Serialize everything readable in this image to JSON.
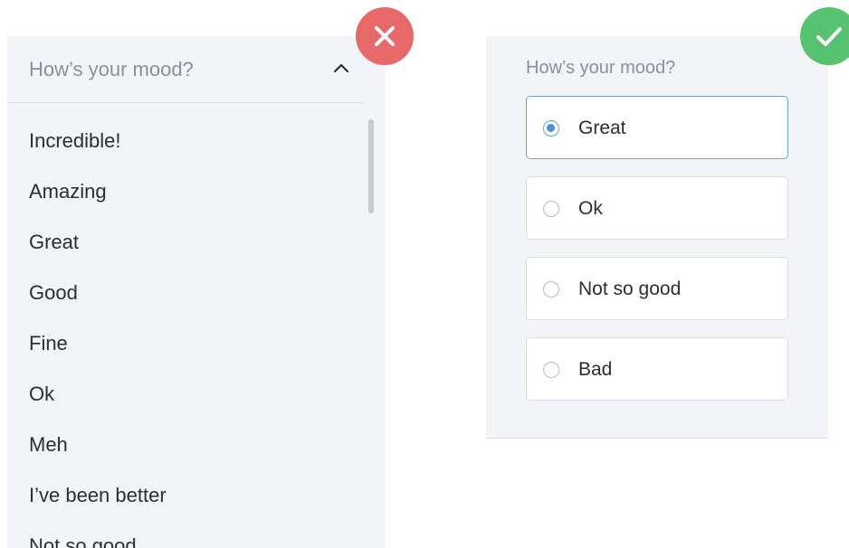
{
  "dropdown_example": {
    "question_label": "How’s your mood?",
    "options": [
      "Incredible!",
      "Amazing",
      "Great",
      "Good",
      "Fine",
      "Ok",
      "Meh",
      "I’ve been better",
      "Not so good"
    ],
    "badge_icon": "close-icon",
    "badge_color": "#e8696a"
  },
  "radio_example": {
    "question_label": "How’s your mood?",
    "options": [
      {
        "label": "Great",
        "selected": true
      },
      {
        "label": "Ok",
        "selected": false
      },
      {
        "label": "Not so good",
        "selected": false
      },
      {
        "label": "Bad",
        "selected": false
      }
    ],
    "badge_icon": "checkmark-icon",
    "badge_color": "#57c26f",
    "selected_color": "#4f8fe2"
  }
}
